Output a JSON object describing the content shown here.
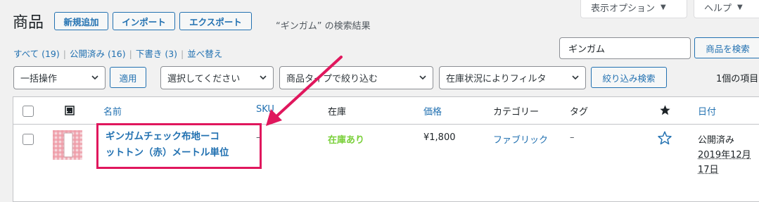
{
  "screen_options": {
    "display_options_label": "表示オプション",
    "help_label": "ヘルプ"
  },
  "header": {
    "title": "商品",
    "add_new_label": "新規追加",
    "import_label": "インポート",
    "export_label": "エクスポート",
    "search_results_subtitle": "“ギンガム” の検索結果"
  },
  "views": {
    "all": "すべて (19)",
    "published": "公開済み (16)",
    "drafts": "下書き (3)",
    "sort": "並べ替え"
  },
  "search": {
    "value": "ギンガム",
    "button_label": "商品を検索"
  },
  "filters": {
    "bulk_action": "一括操作",
    "apply_label": "適用",
    "category_select": "選択してください",
    "product_type_select": "商品タイプで絞り込む",
    "stock_status_select": "在庫状況によりフィルタ",
    "filter_button": "絞り込み検索",
    "items_count": "1個の項目"
  },
  "table": {
    "columns": {
      "name": "名前",
      "sku": "SKU",
      "stock": "在庫",
      "price": "価格",
      "categories": "カテゴリー",
      "tags": "タグ",
      "date": "日付"
    },
    "rows": [
      {
        "name_line1": "ギンガムチェック布地ーコ",
        "name_line2": "ットトン（赤）メートル単位",
        "sku": "–",
        "stock": "在庫あり",
        "price": "¥1,800",
        "category": "ファブリック",
        "tags": "–",
        "date_status": "公開済み",
        "date_line1": "2019年12月",
        "date_line2": "17日"
      }
    ]
  },
  "colors": {
    "link": "#2271b1",
    "in_stock": "#7ad03a",
    "annotation": "#e0175d"
  }
}
